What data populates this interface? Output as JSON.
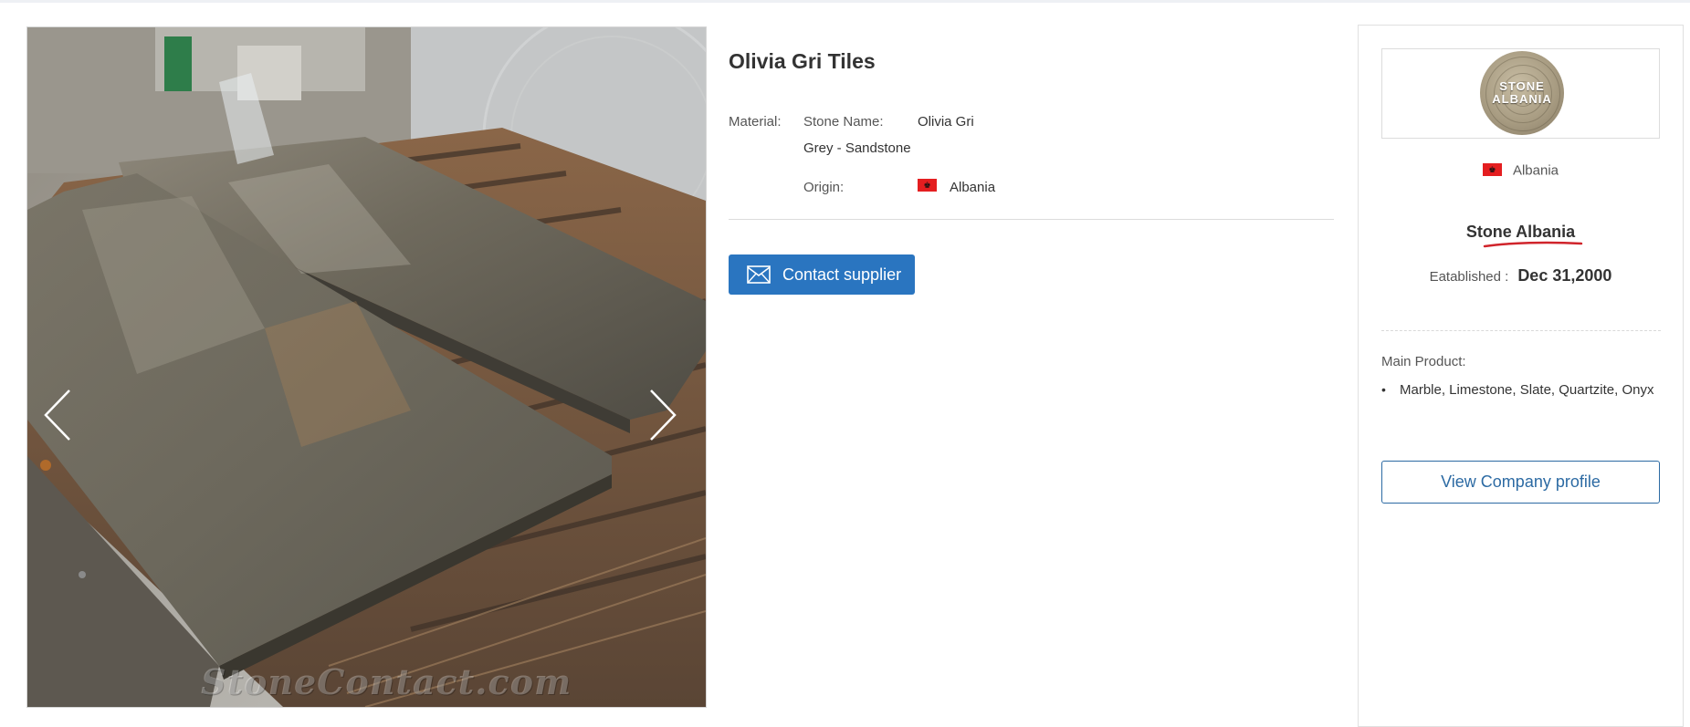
{
  "product": {
    "title": "Olivia Gri Tiles",
    "material_label": "Material:",
    "stone_name_label": "Stone Name:",
    "stone_name_value": "Olivia Gri",
    "stone_type": "Grey - Sandstone",
    "origin_label": "Origin:",
    "origin_value": "Albania",
    "contact_button": "Contact supplier",
    "image_watermark": "StoneContact.com"
  },
  "supplier": {
    "logo_text_line1": "STONE",
    "logo_text_line2": "ALBANIA",
    "country": "Albania",
    "company_name": "Stone Albania",
    "established_label": "Eatablished :",
    "established_value": "Dec 31,2000",
    "main_product_label": "Main Product:",
    "main_products": [
      "Marble, Limestone, Slate, Quartzite, Onyx"
    ],
    "profile_button": "View Company profile"
  },
  "icons": {
    "prev": "chevron-left-icon",
    "next": "chevron-right-icon",
    "contact": "envelope-icon",
    "flag": "albania-flag-icon"
  },
  "colors": {
    "primary_button": "#2a75c0",
    "outline_button": "#2c6aa3",
    "flag_red": "#e41e20",
    "underline_red": "#d0242b"
  }
}
